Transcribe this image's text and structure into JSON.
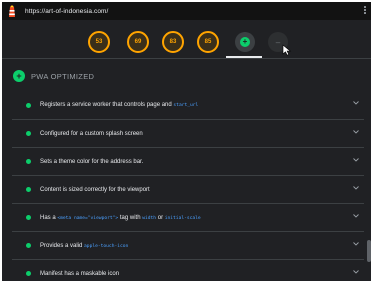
{
  "browser": {
    "url": "https://art-of-indonesia.com/"
  },
  "scores": [
    {
      "label": "performance",
      "value": "53"
    },
    {
      "label": "accessibility",
      "value": "69"
    },
    {
      "label": "best-practices",
      "value": "83"
    },
    {
      "label": "seo",
      "value": "85"
    }
  ],
  "pwa_badge": {
    "icon": "check-plus-icon"
  },
  "plugin_badge": {
    "icon": "dash-icon"
  },
  "category": {
    "title": "PWA OPTIMIZED",
    "color": "#0cce6b"
  },
  "audits": [
    {
      "prefix": "Registers a service worker that controls page and ",
      "code": "start_url",
      "suffix": ""
    },
    {
      "prefix": "Configured for a custom splash screen",
      "code": "",
      "suffix": ""
    },
    {
      "prefix": "Sets a theme color for the address bar.",
      "code": "",
      "suffix": ""
    },
    {
      "prefix": "Content is sized correctly for the viewport",
      "code": "",
      "suffix": ""
    },
    {
      "prefix": "Has a ",
      "code": "<meta name=\"viewport\">",
      "mid": " tag with ",
      "code2": "width",
      "mid2": " or ",
      "code3": "initial-scale",
      "suffix": ""
    },
    {
      "prefix": "Provides a valid ",
      "code": "apple-touch-icon",
      "suffix": ""
    },
    {
      "prefix": "Manifest has a maskable icon",
      "code": "",
      "suffix": ""
    }
  ],
  "colors": {
    "pass": "#0cce6b",
    "average": "#ffa400",
    "link_code": "#4aa0ff",
    "background": "#202124"
  }
}
